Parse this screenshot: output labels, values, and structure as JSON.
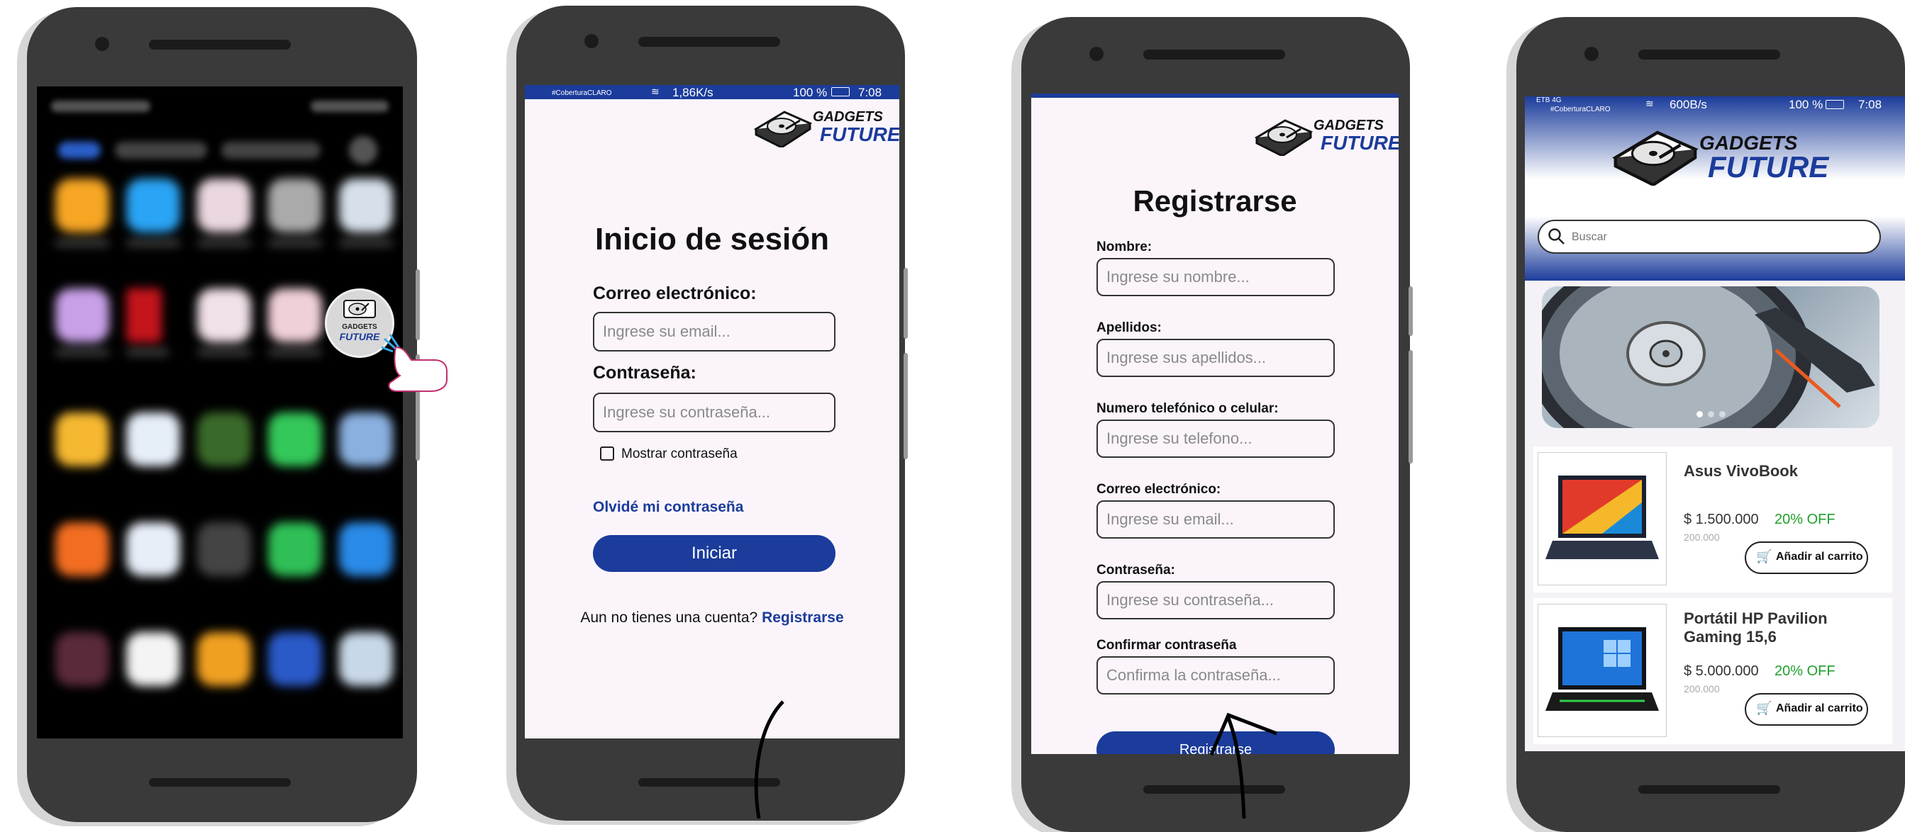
{
  "brand": {
    "line1": "GADGETS",
    "line2": "FUTURE",
    "primary_color": "#1b3c9b",
    "screen_bg": "#fbf5fb"
  },
  "phone1": {
    "icon_line1": "GADGETS",
    "icon_line2": "FUTURE"
  },
  "phone2": {
    "status": {
      "carrier": "#CoberturaCLARO",
      "speed": "1,86K/s",
      "battery": "100 %",
      "time": "7:08"
    },
    "title": "Inicio de sesión",
    "email_label": "Correo electrónico:",
    "email_placeholder": "Ingrese su email...",
    "password_label": "Contraseña:",
    "password_placeholder": "Ingrese su contraseña...",
    "show_password": "Mostrar contraseña",
    "forgot": "Olvidé mi contraseña",
    "submit": "Iniciar",
    "no_account": "Aun no tienes una cuenta?",
    "register_link": "Registrarse"
  },
  "phone3": {
    "title": "Registrarse",
    "fields": [
      {
        "label": "Nombre:",
        "placeholder": "Ingrese su nombre..."
      },
      {
        "label": "Apellidos:",
        "placeholder": "Ingrese sus apellidos..."
      },
      {
        "label": "Numero telefónico o celular:",
        "placeholder": "Ingrese su telefono..."
      },
      {
        "label": "Correo electrónico:",
        "placeholder": "Ingrese su email..."
      },
      {
        "label": "Contraseña:",
        "placeholder": "Ingrese su contraseña..."
      },
      {
        "label": "Confirmar contraseña",
        "placeholder": "Confirma la contraseña..."
      }
    ],
    "submit": "Registrarse"
  },
  "phone4": {
    "status": {
      "network": "ETB 4G",
      "carrier": "#CoberturaCLARO",
      "speed": "600B/s",
      "battery": "100 %",
      "time": "7:08"
    },
    "search_placeholder": "Buscar",
    "products": [
      {
        "name": "Asus VivoBook",
        "price": "$ 1.500.000",
        "discount": "20% OFF",
        "old_price": "200.000",
        "add": "Añadir al carrito"
      },
      {
        "name": "Portátil HP Pavilion Gaming 15,6",
        "price": "$ 5.000.000",
        "discount": "20% OFF",
        "old_price": "200.000",
        "add": "Añadir al carrito"
      }
    ],
    "discount_color": "#1fa02c"
  }
}
